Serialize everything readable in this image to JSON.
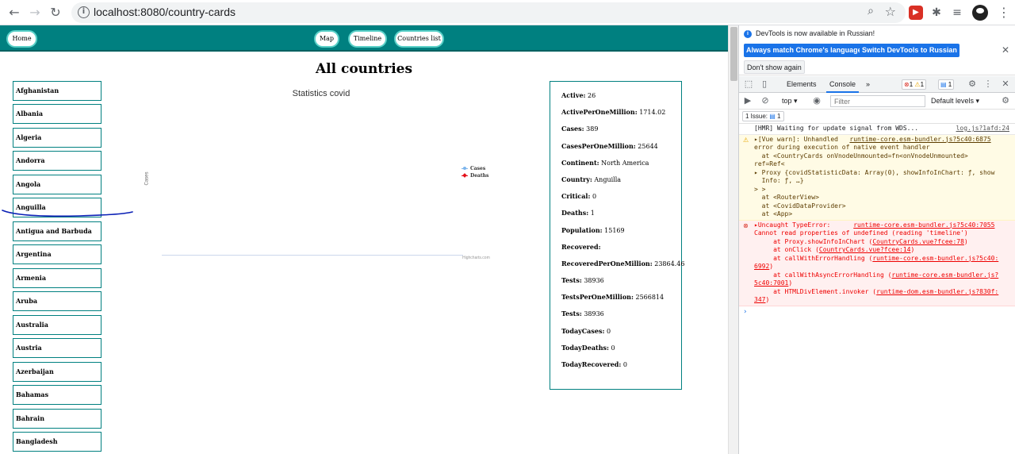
{
  "browser": {
    "back": "←",
    "forward": "→",
    "reload": "↻",
    "info_icon": "i",
    "url": "localhost:8080/country-cards",
    "zoom_icon": "⌕",
    "star_icon": "☆",
    "ext_puzzle": "✱",
    "ext_list": "≡",
    "menu": "⋮"
  },
  "nav": {
    "home": "Home",
    "map": "Map",
    "timeline": "Timeline",
    "countries": "Countries list"
  },
  "page_title": "All countries",
  "countries": [
    "Afghanistan",
    "Albania",
    "Algeria",
    "Andorra",
    "Angola",
    "Anguilla",
    "Antigua and Barbuda",
    "Argentina",
    "Armenia",
    "Aruba",
    "Australia",
    "Austria",
    "Azerbaijan",
    "Bahamas",
    "Bahrain",
    "Bangladesh"
  ],
  "chart": {
    "title": "Statistics covid",
    "ylabel": "Cases",
    "credits": "Highcharts.com",
    "legend": [
      {
        "label": "Cases",
        "color": "#7cb5ec"
      },
      {
        "label": "Deaths",
        "color": "#e4111b"
      }
    ]
  },
  "chart_data": {
    "type": "line",
    "title": "Statistics covid",
    "ylabel": "Cases",
    "series": [
      {
        "name": "Cases",
        "values": []
      },
      {
        "name": "Deaths",
        "values": []
      }
    ]
  },
  "stats": [
    {
      "k": "Active:",
      "v": " 26"
    },
    {
      "k": "ActivePerOneMillion:",
      "v": " 1714.02"
    },
    {
      "k": "Cases:",
      "v": " 389"
    },
    {
      "k": "CasesPerOneMillion:",
      "v": " 25644"
    },
    {
      "k": "Continent:",
      "v": " North America"
    },
    {
      "k": "Country:",
      "v": " Anguilla"
    },
    {
      "k": "Critical:",
      "v": " 0"
    },
    {
      "k": "Deaths:",
      "v": " 1"
    },
    {
      "k": "Population:",
      "v": " 15169"
    },
    {
      "k": "Recovered:",
      "v": ""
    },
    {
      "k": "RecoveredPerOneMillion:",
      "v": " 23864.46"
    },
    {
      "k": "Tests:",
      "v": " 38936"
    },
    {
      "k": "TestsPerOneMillion:",
      "v": " 2566814"
    },
    {
      "k": "Tests:",
      "v": " 38936"
    },
    {
      "k": "TodayCases:",
      "v": " 0"
    },
    {
      "k": "TodayDeaths:",
      "v": " 0"
    },
    {
      "k": "TodayRecovered:",
      "v": " 0"
    }
  ],
  "devtools": {
    "notice": "DevTools is now available in Russian!",
    "btn_match": "Always match Chrome's language",
    "btn_switch": "Switch DevTools to Russian",
    "btn_dont": "Don't show again",
    "close": "✕",
    "tab_elements": "Elements",
    "tab_console": "Console",
    "more_tabs": "»",
    "err_count": "1",
    "warn_count": "1",
    "msg_count": "1",
    "context": "top ▾",
    "filter_placeholder": "Filter",
    "levels": "Default levels ▾",
    "issues": "1 Issue:",
    "issues_count": "1"
  },
  "console": {
    "hmr_text": "[HMR] Waiting for update signal from WDS...",
    "hmr_src": "log.js?1afd:24",
    "warn_lines": [
      {
        "pre": "▸[Vue warn]: Unhandled   ",
        "link": "runtime-core.esm-bundler.js?5c40:6875",
        "post": ""
      },
      {
        "pre": "error during execution of native event handler",
        "link": "",
        "post": ""
      },
      {
        "pre": "  at <CountryCards onVnodeUnmounted=fn<onVnodeUnmounted>",
        "link": "",
        "post": ""
      },
      {
        "pre": "ref=Ref<",
        "link": "",
        "post": ""
      },
      {
        "pre": "▸ Proxy {covidStatisticData: Array(0), showInfoInChart: ƒ, show",
        "link": "",
        "post": ""
      },
      {
        "pre": "  Info: ƒ, …}",
        "link": "",
        "post": ""
      },
      {
        "pre": "> >",
        "link": "",
        "post": ""
      },
      {
        "pre": "  at <RouterView>",
        "link": "",
        "post": ""
      },
      {
        "pre": "  at <CovidDataProvider>",
        "link": "",
        "post": ""
      },
      {
        "pre": "  at <App>",
        "link": "",
        "post": ""
      }
    ],
    "err_lines": [
      {
        "pre": "▸Uncaught TypeError:      ",
        "link": "runtime-core.esm-bundler.js?5c40:7055",
        "post": ""
      },
      {
        "pre": "Cannot read properties of undefined (reading 'timeline')",
        "link": "",
        "post": ""
      },
      {
        "pre": "     at Proxy.showInfoInChart (",
        "link": "CountryCards.vue?fcee:78",
        "post": ")"
      },
      {
        "pre": "     at onClick (",
        "link": "CountryCards.vue?fcee:14",
        "post": ")"
      },
      {
        "pre": "     at callWithErrorHandling (",
        "link": "runtime-core.esm-bundler.js?5c40:",
        "post": ""
      },
      {
        "pre": "",
        "link": "6992",
        "post": ")"
      },
      {
        "pre": "     at callWithAsyncErrorHandling (",
        "link": "runtime-core.esm-bundler.js?",
        "post": ""
      },
      {
        "pre": "",
        "link": "5c40:7001",
        "post": ")"
      },
      {
        "pre": "     at HTMLDivElement.invoker (",
        "link": "runtime-dom.esm-bundler.js?830f:",
        "post": ""
      },
      {
        "pre": "",
        "link": "347",
        "post": ")"
      }
    ],
    "prompt": "›"
  }
}
